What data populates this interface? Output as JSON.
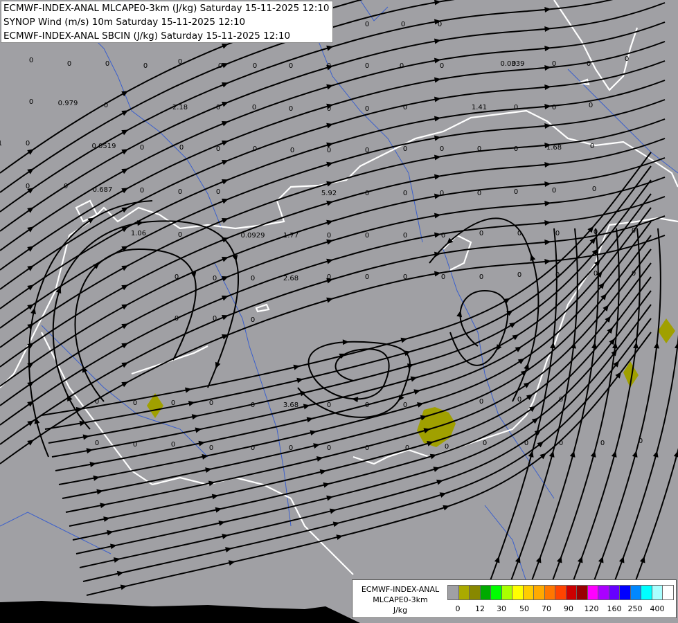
{
  "titles": [
    "ECMWF-INDEX-ANAL MLCAPE0-3km (J/kg) Saturday 15-11-2025 12:10",
    "SYNOP Wind (m/s) 10m Saturday 15-11-2025 12:10",
    "ECMWF-INDEX-ANAL SBCIN (J/kg) Saturday 15-11-2025 12:10"
  ],
  "legend": {
    "caption": [
      "ECMWF-INDEX-ANAL",
      "MLCAPE0-3km",
      "J/kg"
    ],
    "colors": [
      "#a0a0a4",
      "#aaaa00",
      "#888800",
      "#00aa00",
      "#00ff00",
      "#aaff00",
      "#ffff00",
      "#ffcc00",
      "#ffaa00",
      "#ff7700",
      "#ff4400",
      "#cc0000",
      "#990000",
      "#ff00ff",
      "#aa00ff",
      "#6600ff",
      "#0000ff",
      "#0088ff",
      "#00ffff",
      "#aaffff",
      "#ffffff"
    ],
    "ticks": [
      "0",
      "12",
      "30",
      "50",
      "70",
      "90",
      "120",
      "160",
      "250",
      "400"
    ]
  },
  "values": [
    {
      "v": "0"
    },
    {
      "v": "0"
    },
    {
      "v": "0"
    },
    {
      "v": "0"
    },
    {
      "v": "0"
    },
    {
      "v": "0"
    },
    {
      "v": "0"
    },
    {
      "v": "0"
    },
    {
      "v": "0"
    },
    {
      "v": "0"
    },
    {
      "v": "0"
    },
    {
      "v": "0"
    },
    {
      "v": "0"
    },
    {
      "v": "0"
    },
    {
      "v": "0"
    },
    {
      "v": "0"
    },
    {
      "v": "0.0339"
    },
    {
      "v": "0"
    },
    {
      "v": "0"
    },
    {
      "v": "0"
    },
    {
      "v": "0"
    },
    {
      "v": "0.979"
    },
    {
      "v": "0"
    },
    {
      "v": "2.18"
    },
    {
      "v": "0"
    },
    {
      "v": "0"
    },
    {
      "v": "0"
    },
    {
      "v": "0"
    },
    {
      "v": "0"
    },
    {
      "v": "0"
    },
    {
      "v": "1.41"
    },
    {
      "v": "0"
    },
    {
      "v": "0"
    },
    {
      "v": "0"
    },
    {
      "v": "1"
    },
    {
      "v": "0"
    },
    {
      "v": "0.0519"
    },
    {
      "v": "0"
    },
    {
      "v": "0"
    },
    {
      "v": "0"
    },
    {
      "v": "0"
    },
    {
      "v": "0"
    },
    {
      "v": "0"
    },
    {
      "v": "0"
    },
    {
      "v": "0"
    },
    {
      "v": "0"
    },
    {
      "v": "0"
    },
    {
      "v": "0"
    },
    {
      "v": "1.68"
    },
    {
      "v": "0"
    },
    {
      "v": "0"
    },
    {
      "v": "0"
    },
    {
      "v": "0.687"
    },
    {
      "v": "0"
    },
    {
      "v": "0"
    },
    {
      "v": "0"
    },
    {
      "v": "5.92"
    },
    {
      "v": "0"
    },
    {
      "v": "0"
    },
    {
      "v": "0"
    },
    {
      "v": "0"
    },
    {
      "v": "0"
    },
    {
      "v": "0"
    },
    {
      "v": "0"
    },
    {
      "v": "1.06"
    },
    {
      "v": "0"
    },
    {
      "v": "0.0929"
    },
    {
      "v": "1.77"
    },
    {
      "v": "0"
    },
    {
      "v": "0"
    },
    {
      "v": "0"
    },
    {
      "v": "0"
    },
    {
      "v": "0"
    },
    {
      "v": "0"
    },
    {
      "v": "0"
    },
    {
      "v": "0"
    },
    {
      "v": "0"
    },
    {
      "v": "2.68"
    },
    {
      "v": "0"
    },
    {
      "v": "0"
    },
    {
      "v": "0"
    },
    {
      "v": "0"
    },
    {
      "v": "0"
    },
    {
      "v": "0"
    },
    {
      "v": "0"
    },
    {
      "v": "0"
    },
    {
      "v": "0"
    },
    {
      "v": "0"
    },
    {
      "v": "0"
    },
    {
      "v": "0"
    },
    {
      "v": "0"
    },
    {
      "v": "0"
    },
    {
      "v": "0"
    },
    {
      "v": "3.68"
    },
    {
      "v": "0"
    },
    {
      "v": "0"
    },
    {
      "v": "0"
    },
    {
      "v": "0"
    },
    {
      "v": "0"
    },
    {
      "v": "0"
    },
    {
      "v": "0"
    },
    {
      "v": "0"
    },
    {
      "v": "0"
    },
    {
      "v": "0"
    },
    {
      "v": "0"
    },
    {
      "v": "0"
    },
    {
      "v": "0"
    },
    {
      "v": "0"
    },
    {
      "v": "0"
    },
    {
      "v": "0"
    },
    {
      "v": "0"
    },
    {
      "v": "0"
    },
    {
      "v": "0"
    },
    {
      "v": "0"
    },
    {
      "v": "0"
    },
    {
      "v": "0"
    },
    {
      "v": "0"
    },
    {
      "v": "0"
    },
    {
      "v": "0"
    },
    {
      "v": "0"
    }
  ]
}
